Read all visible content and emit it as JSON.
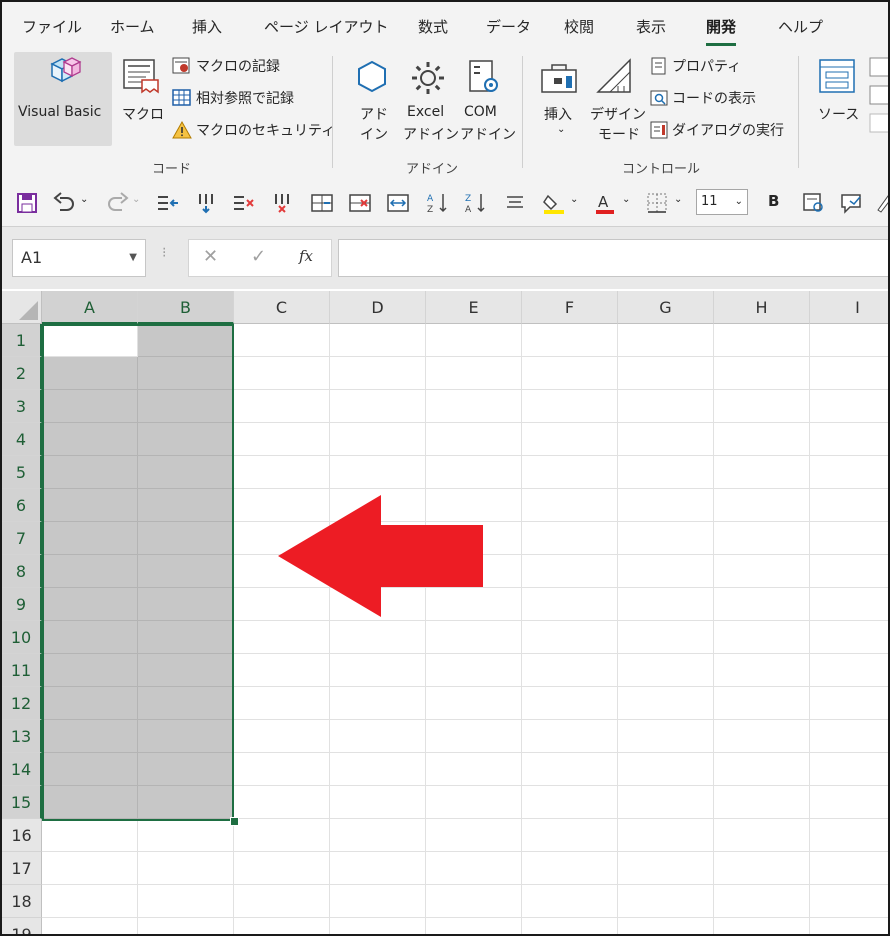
{
  "ribbon_tabs": [
    "ファイル",
    "ホーム",
    "挿入",
    "ページ レイアウト",
    "数式",
    "データ",
    "校閲",
    "表示",
    "開発",
    "ヘルプ"
  ],
  "active_tab": "開発",
  "ribbon": {
    "code_group": {
      "label": "コード",
      "visual_basic": "Visual Basic",
      "macro": "マクロ",
      "record_macro": "マクロの記録",
      "relative_ref": "相対参照で記録",
      "macro_security": "マクロのセキュリティ"
    },
    "addins_group": {
      "label": "アドイン",
      "addins_line1": "アド",
      "addins_line2": "イン",
      "excel_line1": "Excel",
      "excel_line2": "アドイン",
      "com_line1": "COM",
      "com_line2": "アドイン"
    },
    "controls_group": {
      "label": "コントロール",
      "insert": "挿入",
      "design_line1": "デザイン",
      "design_line2": "モード",
      "properties": "プロパティ",
      "view_code": "コードの表示",
      "run_dialog": "ダイアログの実行"
    },
    "xml_group": {
      "source": "ソース"
    }
  },
  "quick_access": {
    "font_size": "11",
    "bold_label": "B"
  },
  "formula_bar": {
    "name_box": "A1",
    "fx_label": "fx",
    "formula": ""
  },
  "columns": [
    "A",
    "B",
    "C",
    "D",
    "E",
    "F",
    "G",
    "H",
    "I"
  ],
  "rows": [
    "1",
    "2",
    "3",
    "4",
    "5",
    "6",
    "7",
    "8",
    "9",
    "10",
    "11",
    "12",
    "13",
    "14",
    "15",
    "16",
    "17",
    "18",
    "19"
  ],
  "selection": "A1:B15",
  "colors": {
    "excel_green": "#1e6e42",
    "selection_fill": "#c7c7c7",
    "arrow_red": "#ed1c24"
  }
}
